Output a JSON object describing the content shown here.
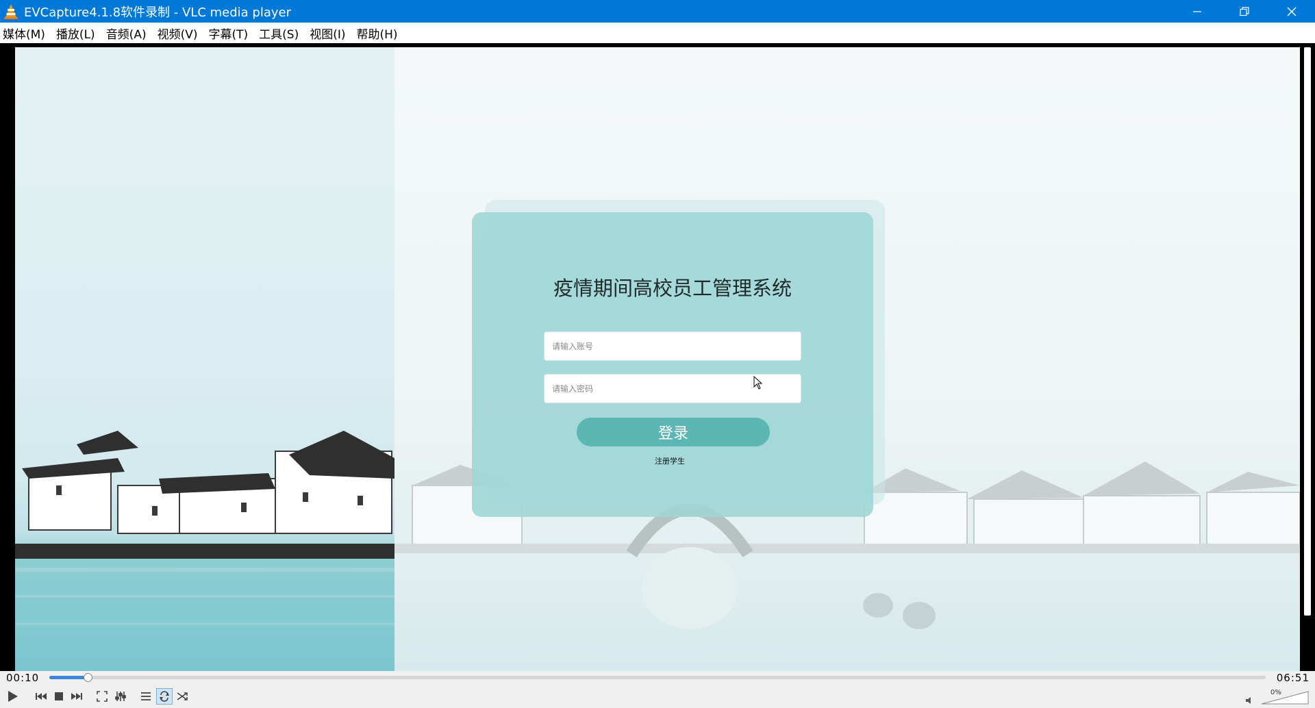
{
  "window": {
    "title": "EVCapture4.1.8软件录制 - VLC media player",
    "icon": "vlc-cone-icon",
    "accent": "#0078d7"
  },
  "menu": {
    "items": [
      "媒体(M)",
      "播放(L)",
      "音频(A)",
      "视频(V)",
      "字幕(T)",
      "工具(S)",
      "视图(I)",
      "帮助(H)"
    ]
  },
  "login": {
    "title": "疫情期间高校员工管理系统",
    "username_placeholder": "请输入账号",
    "password_placeholder": "请输入密码",
    "login_label": "登录",
    "register_label": "注册学生",
    "card_color": "#a0d6d6",
    "button_color": "#5cb6b3"
  },
  "player": {
    "elapsed": "00:10",
    "total": "06:51",
    "progress_fraction": 0.025,
    "volume": "0%"
  }
}
